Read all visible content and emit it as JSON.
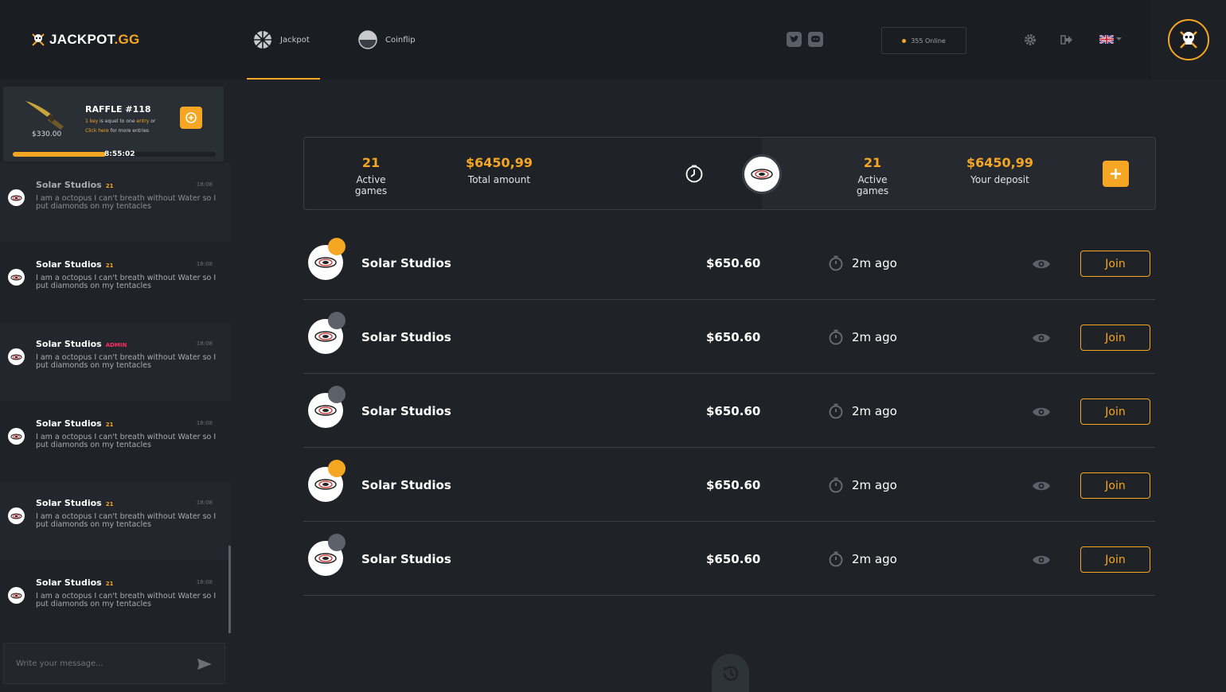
{
  "brand": {
    "name": "JACKPOT",
    "suffix": ".GG"
  },
  "nav": [
    {
      "label": "Jackpot",
      "icon": "jackpot-wheel-icon",
      "active": true
    },
    {
      "label": "Coinflip",
      "icon": "coinflip-icon",
      "active": false
    }
  ],
  "header": {
    "online": "355 Online",
    "socials": [
      "twitter-icon",
      "discord-icon"
    ],
    "settings_icon": "gear-icon",
    "logout_icon": "logout-icon",
    "language": "UK flag"
  },
  "raffle": {
    "title": "RAFFLE #118",
    "price": "$330.00",
    "line1_pre": "1 key",
    "line1_mid": " is equel to one ",
    "line1_hl": "entry",
    "line1_post": " or",
    "line2_link": "Click here",
    "line2_post": " for more entries",
    "timer": "8:55:02",
    "progress": 0.46
  },
  "chat": {
    "messages": [
      {
        "name": "Solar Studios",
        "level": "21",
        "time": "18:08",
        "text": "I am a octopus I can't breath without Water so I put diamonds on my tentacles"
      },
      {
        "name": "Solar Studios",
        "level": "21",
        "time": "18:08",
        "text": "I am a octopus I can't breath without Water so I put diamonds on my tentacles"
      },
      {
        "name": "Solar Studios",
        "level": "ADMIN",
        "time": "18:08",
        "text": "I am a octopus I can't breath without Water so I put diamonds on my tentacles"
      },
      {
        "name": "Solar Studios",
        "level": "21",
        "time": "18:08",
        "text": "I am a octopus I can't breath without Water so I put diamonds on my tentacles"
      },
      {
        "name": "Solar Studios",
        "level": "21",
        "time": "18:08",
        "text": "I am a octopus I can't breath without Water so I put diamonds on my tentacles"
      },
      {
        "name": "Solar Studios",
        "level": "21",
        "time": "18:08",
        "text": "I am a octopus I can't breath without Water so I put diamonds on my tentacles"
      }
    ],
    "placeholder": "Write your message..."
  },
  "stats": {
    "active_games_left": "21",
    "active_games_left_label": "Active games",
    "total_amount": "$6450,99",
    "total_amount_label": "Total amount",
    "active_games_right": "21",
    "active_games_right_label": "Active games",
    "your_deposit": "$6450,99",
    "your_deposit_label": "Your deposit"
  },
  "games": [
    {
      "name": "Solar Studios",
      "amount": "$650.60",
      "time": "2m ago",
      "join": "Join",
      "badge": "orange"
    },
    {
      "name": "Solar Studios",
      "amount": "$650.60",
      "time": "2m ago",
      "join": "Join",
      "badge": "grey"
    },
    {
      "name": "Solar Studios",
      "amount": "$650.60",
      "time": "2m ago",
      "join": "Join",
      "badge": "grey"
    },
    {
      "name": "Solar Studios",
      "amount": "$650.60",
      "time": "2m ago",
      "join": "Join",
      "badge": "orange"
    },
    {
      "name": "Solar Studios",
      "amount": "$650.60",
      "time": "2m ago",
      "join": "Join",
      "badge": "grey"
    }
  ],
  "colors": {
    "accent": "#f5a623",
    "background": "#1f2227",
    "panel": "#23262c",
    "admin": "#ff2e5e"
  }
}
